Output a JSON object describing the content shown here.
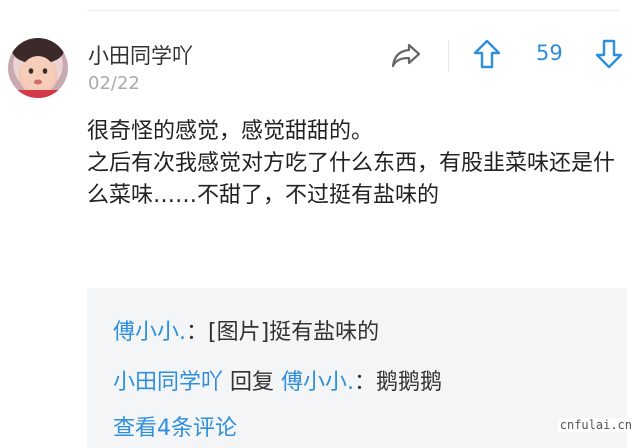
{
  "comment": {
    "username": "小田同学吖",
    "date": "02/22",
    "vote_count": "59",
    "text": "很奇怪的感觉，感觉甜甜的。\n之后有次我感觉对方吃了什么东西，有股韭菜味还是什么菜味……不甜了，不过挺有盐味的"
  },
  "replies": [
    {
      "author": "傅小小.",
      "separator": "：",
      "content": "[图片]挺有盐味的"
    },
    {
      "author": "小田同学吖",
      "reply_word": "回复",
      "target": "傅小小.",
      "separator": "：",
      "content": "鹅鹅鹅"
    }
  ],
  "more_replies_label": "查看4条评论",
  "watermark": "cnfulai.cn",
  "colors": {
    "accent": "#2f8fdc",
    "reply_bg": "#f4f5f7"
  },
  "icons": [
    "avatar",
    "share-icon",
    "thumb-up-arrow-icon",
    "thumb-down-arrow-icon"
  ]
}
